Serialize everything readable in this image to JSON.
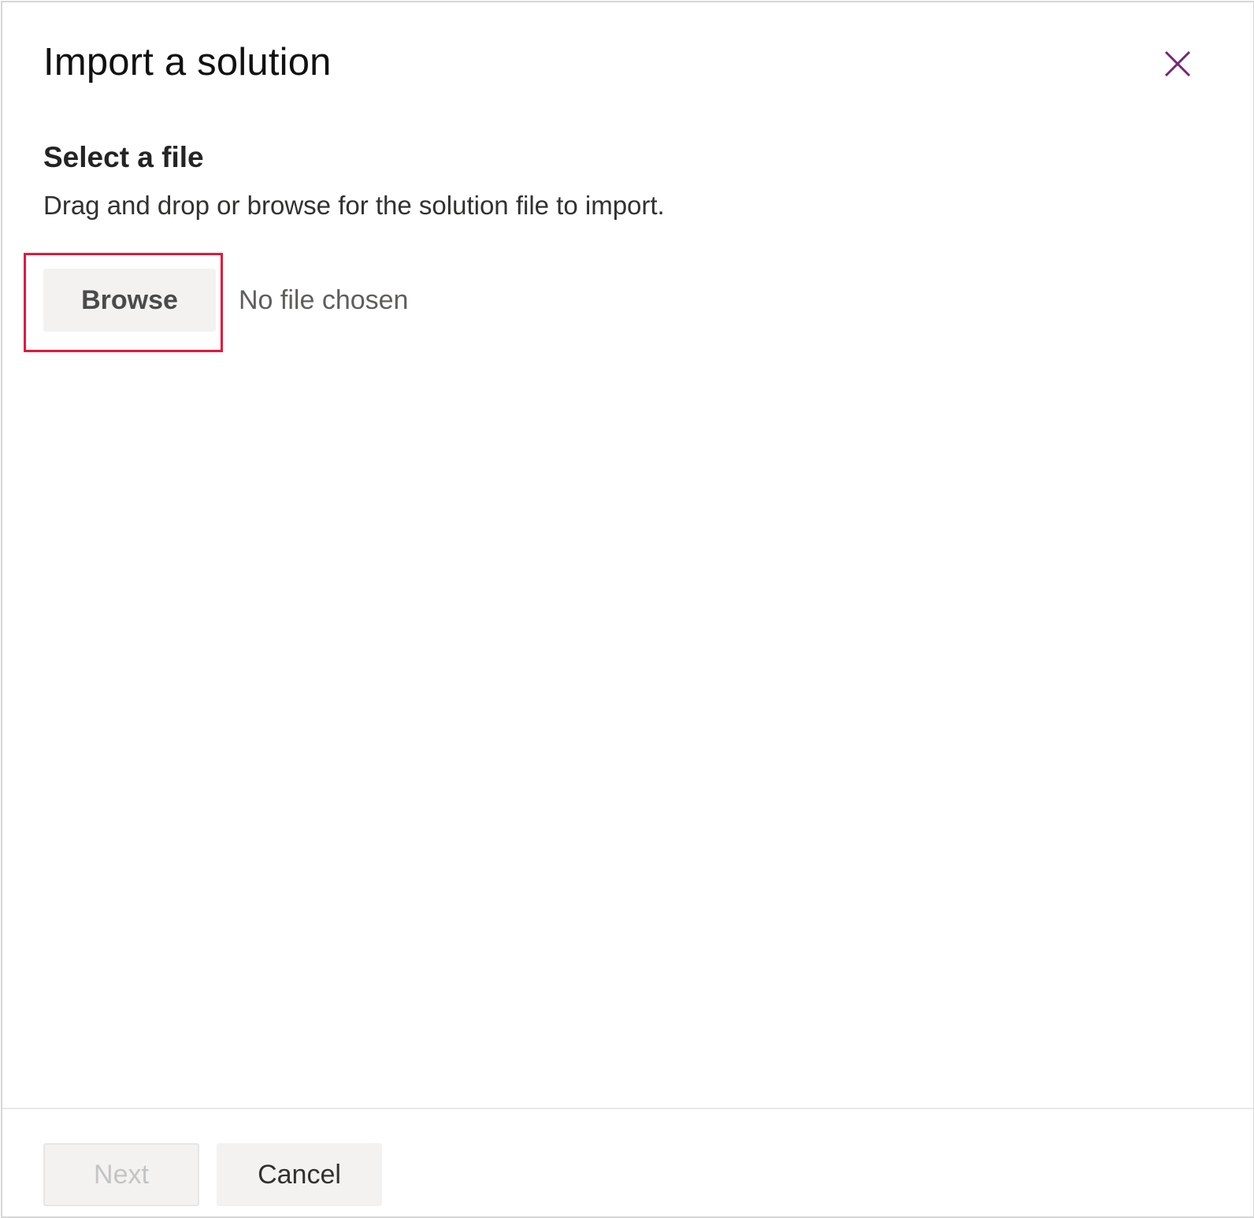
{
  "dialog": {
    "title": "Import a solution",
    "close_icon": "close-icon",
    "accent_color": "#742774"
  },
  "section": {
    "heading": "Select a file",
    "description": "Drag and drop or browse for the solution file to import."
  },
  "file_picker": {
    "browse_label": "Browse",
    "status_text": "No file chosen",
    "highlight_color": "#e3173e"
  },
  "footer": {
    "next_label": "Next",
    "cancel_label": "Cancel"
  }
}
